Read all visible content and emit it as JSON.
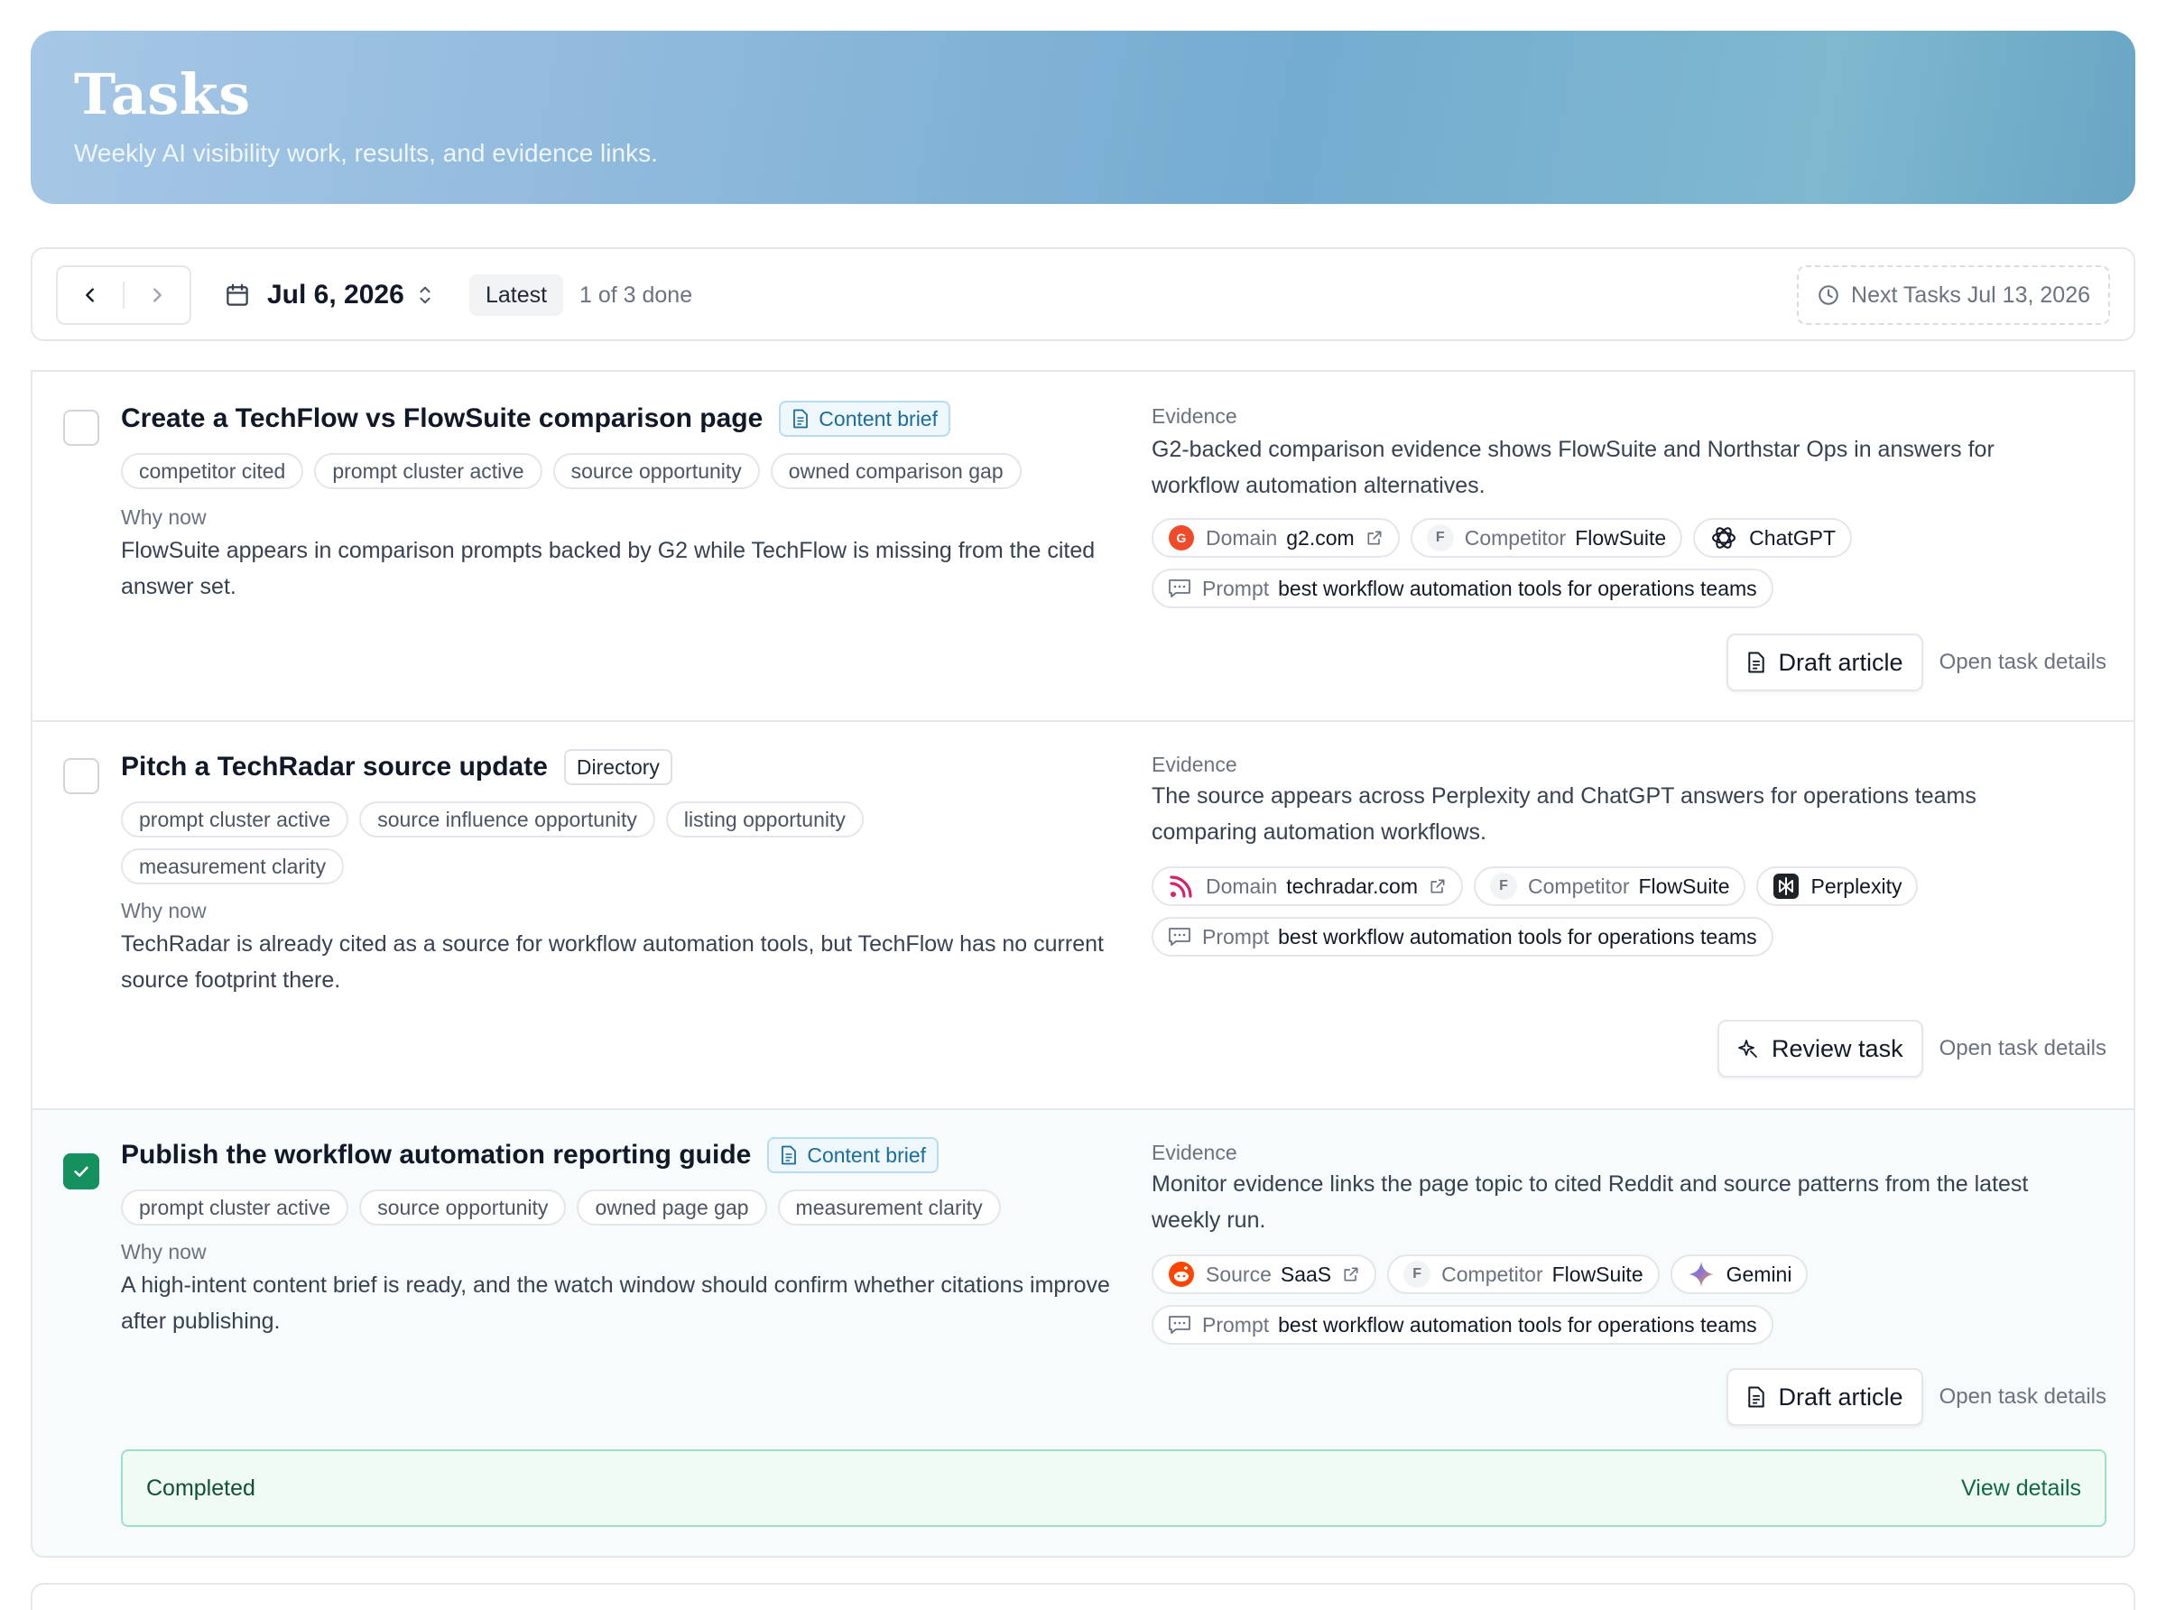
{
  "header": {
    "title": "Tasks",
    "subtitle": "Weekly AI visibility work, results, and evidence links."
  },
  "toolbar": {
    "date": "Jul 6, 2026",
    "latest_label": "Latest",
    "progress": "1 of 3 done",
    "next_tasks": "Next Tasks Jul 13, 2026"
  },
  "tasks": [
    {
      "title": "Create a TechFlow vs FlowSuite comparison page",
      "badge": "Content brief",
      "done": false,
      "tags": [
        "competitor cited",
        "prompt cluster active",
        "source opportunity",
        "owned comparison gap"
      ],
      "why_label": "Why now",
      "why_text": "FlowSuite appears in comparison prompts backed by G2 while TechFlow is missing from the cited answer set.",
      "evidence_label": "Evidence",
      "evidence_text": "G2-backed comparison evidence shows FlowSuite and Northstar Ops in answers for workflow automation alternatives.",
      "chips": {
        "domain_label": "Domain",
        "domain_value": "g2.com",
        "competitor_label": "Competitor",
        "competitor_value": "FlowSuite",
        "engine": "ChatGPT",
        "prompt_label": "Prompt",
        "prompt_value": "best workflow automation tools for operations teams"
      },
      "action": "Draft article",
      "details_link": "Open task details"
    },
    {
      "title": "Pitch a TechRadar source update",
      "badge": "Directory",
      "done": false,
      "tags": [
        "prompt cluster active",
        "source influence opportunity",
        "listing opportunity",
        "measurement clarity"
      ],
      "why_label": "Why now",
      "why_text": "TechRadar is already cited as a source for workflow automation tools, but TechFlow has no current source footprint there.",
      "evidence_label": "Evidence",
      "evidence_text": "The source appears across Perplexity and ChatGPT answers for operations teams comparing automation workflows.",
      "chips": {
        "domain_label": "Domain",
        "domain_value": "techradar.com",
        "competitor_label": "Competitor",
        "competitor_value": "FlowSuite",
        "engine": "Perplexity",
        "prompt_label": "Prompt",
        "prompt_value": "best workflow automation tools for operations teams"
      },
      "action": "Review task",
      "details_link": "Open task details"
    },
    {
      "title": "Publish the workflow automation reporting guide",
      "badge": "Content brief",
      "done": true,
      "tags": [
        "prompt cluster active",
        "source opportunity",
        "owned page gap",
        "measurement clarity"
      ],
      "why_label": "Why now",
      "why_text": "A high-intent content brief is ready, and the watch window should confirm whether citations improve after publishing.",
      "evidence_label": "Evidence",
      "evidence_text": "Monitor evidence links the page topic to cited Reddit and source patterns from the latest weekly run.",
      "chips": {
        "domain_label": "Source",
        "domain_value": "SaaS",
        "competitor_label": "Competitor",
        "competitor_value": "FlowSuite",
        "engine": "Gemini",
        "prompt_label": "Prompt",
        "prompt_value": "best workflow automation tools for operations teams"
      },
      "action": "Draft article",
      "details_link": "Open task details",
      "completed_label": "Completed",
      "view_details": "View details"
    }
  ],
  "competitor_initial": "F",
  "colors": {
    "accent": "#1b6d99",
    "success": "#15905f",
    "g2": "#ef4b2b",
    "reddit": "#ff4500",
    "techradar": "#d6216f"
  }
}
